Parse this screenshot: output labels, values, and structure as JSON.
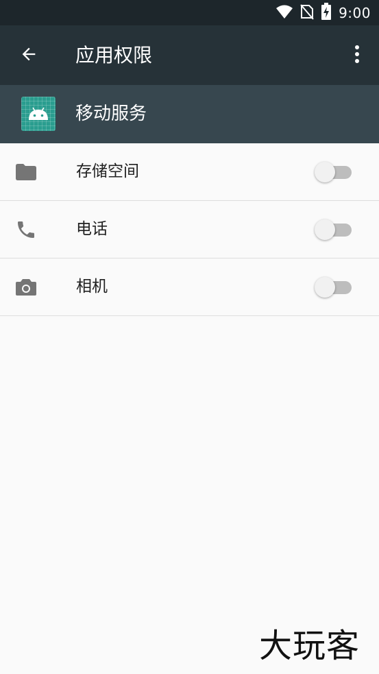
{
  "status_bar": {
    "time": "9:00",
    "icons": [
      "wifi-icon",
      "no-sim-icon",
      "battery-charging-icon"
    ]
  },
  "app_bar": {
    "title": "应用权限",
    "back_icon": "arrow-back-icon",
    "menu_icon": "more-vert-icon"
  },
  "app_header": {
    "name": "移动服务",
    "icon": "android-app-icon",
    "icon_color": "#2a9d8f"
  },
  "permissions": [
    {
      "label": "存储空间",
      "icon": "folder-icon",
      "enabled": false
    },
    {
      "label": "电话",
      "icon": "phone-icon",
      "enabled": false
    },
    {
      "label": "相机",
      "icon": "camera-icon",
      "enabled": false
    }
  ],
  "watermark": "大玩客",
  "colors": {
    "status_bar": "#1d262b",
    "app_bar": "#263238",
    "app_header": "#37474f",
    "background": "#fafafa",
    "switch_track_off": "#bdbdbd",
    "switch_thumb_off": "#f1f1f1"
  }
}
